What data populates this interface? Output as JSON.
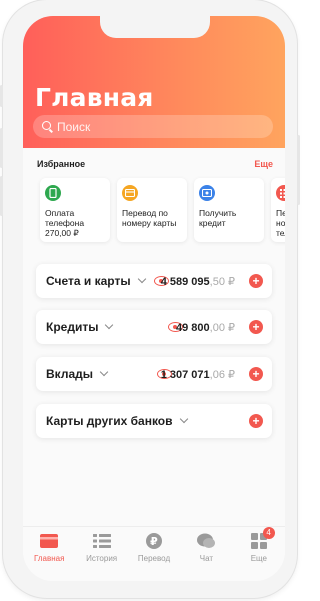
{
  "header": {
    "title": "Главная",
    "search_placeholder": "Поиск"
  },
  "favorites": {
    "heading": "Избранное",
    "more": "Еще",
    "items": [
      {
        "label": "Оплата телефона",
        "amount": "270,00 ₽",
        "icon": "phone-icon",
        "color": "#2ea84f"
      },
      {
        "label": "Перевод по номеру карты",
        "icon": "card-icon",
        "color": "#f5a623"
      },
      {
        "label": "Получить кредит",
        "icon": "credit-icon",
        "color": "#3b82e8"
      },
      {
        "label": "Перевод по номеру телефона",
        "icon": "calculator-icon",
        "color": "#f2584f"
      }
    ]
  },
  "accounts": [
    {
      "name": "Счета и карты",
      "amount_main": "4 589 095",
      "amount_dec": ",50 ₽",
      "has_eye": true
    },
    {
      "name": "Кредиты",
      "amount_main": "49 800",
      "amount_dec": ",00 ₽",
      "has_eye": true
    },
    {
      "name": "Вклады",
      "amount_main": "1 307 071",
      "amount_dec": ",06 ₽",
      "has_eye": true
    },
    {
      "name": "Карты других банков",
      "has_eye": false
    }
  ],
  "tabbar": [
    {
      "label": "Главная",
      "icon": "home-card-icon",
      "active": true
    },
    {
      "label": "История",
      "icon": "history-list-icon"
    },
    {
      "label": "Перевод",
      "icon": "ruble-icon"
    },
    {
      "label": "Чат",
      "icon": "chat-icon"
    },
    {
      "label": "Еще",
      "icon": "grid-icon",
      "badge": "4"
    }
  ],
  "colors": {
    "accent": "#f2584f",
    "header_from": "#ff5f5a",
    "header_to": "#ffa45e"
  }
}
